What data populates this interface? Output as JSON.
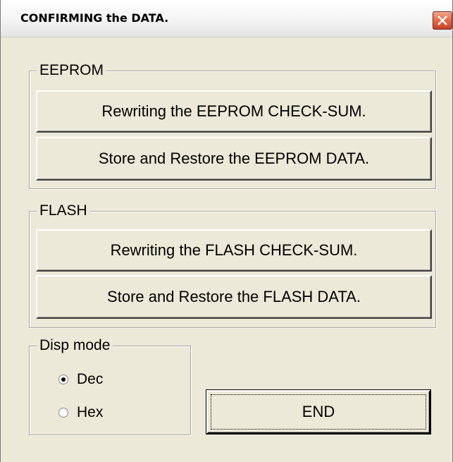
{
  "window": {
    "title": "CONFIRMING the DATA."
  },
  "titlebar": {
    "close_icon": "close-icon"
  },
  "eeprom": {
    "legend": "EEPROM",
    "rewrite_label": "Rewriting the EEPROM CHECK-SUM.",
    "store_label": "Store and Restore the EEPROM DATA."
  },
  "flash": {
    "legend": "FLASH",
    "rewrite_label": "Rewriting the FLASH CHECK-SUM.",
    "store_label": "Store and Restore the FLASH DATA."
  },
  "disp_mode": {
    "legend": "Disp mode",
    "options": [
      {
        "label": "Dec",
        "selected": true
      },
      {
        "label": "Hex",
        "selected": false
      }
    ]
  },
  "end_button": {
    "label": "END"
  },
  "colors": {
    "dialog_bg": "#ece9d8",
    "close_button": "#e56a44"
  }
}
